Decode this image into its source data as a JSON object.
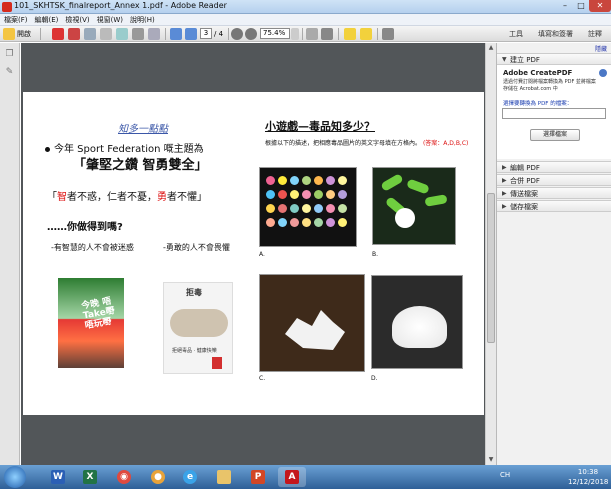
{
  "window": {
    "title": "101_SKHTSK_finalreport_Annex 1.pdf - Adobe Reader",
    "buttons": {
      "minimize": "–",
      "maximize": "□",
      "close": "✕"
    }
  },
  "menubar": {
    "items": [
      "檔案(F)",
      "編輯(E)",
      "檢視(V)",
      "視窗(W)",
      "說明(H)"
    ]
  },
  "toolbar": {
    "open_label": "開啟",
    "page_current": "3",
    "page_total": "/ 4",
    "zoom": "75.4%",
    "tools_label": "工具",
    "sign_label": "填寫和簽署",
    "comment_label": "註釋"
  },
  "document": {
    "left": {
      "heading": "知多一點點",
      "line1": "今年 Sport Federation 嘅主題為",
      "line2": "「肇堅之鑽 智勇雙全」",
      "line3_q1": "「",
      "line3_red1": "智",
      "line3_mid": "者不惑，仁者不憂，",
      "line3_red2": "勇",
      "line3_end": "者不懼」",
      "line4": "……你做得到嗎?",
      "line5": "-有智慧的人不會被迷惑",
      "line6": "-勇敢的人不會畏懼",
      "poster1_text": "今晚 唔Take嘢 唔玩嘢",
      "poster2_top": "拒毒",
      "poster2_text": "拒絕毒品 · 健康快樂"
    },
    "right": {
      "heading": "小遊戲—毒品知多少？",
      "instruction": "根據以下的描述，把相應毒品圖片的英文字母填在方格內。",
      "instruction_red": "(答案：A,D,B,C)",
      "labels": [
        "A.",
        "B.",
        "C.",
        "D."
      ]
    }
  },
  "right_panel": {
    "hide_label": "隱藏",
    "section_create": "建立 PDF",
    "createpdf_title": "Adobe CreatePDF",
    "createpdf_desc": "透過付費訂閱將檔案轉換為 PDF 並將檔案存儲在 Acrobat.com 中",
    "select_link": "選擇要轉換為 PDF 的檔案：",
    "select_button": "選擇檔案",
    "sections": [
      "編輯 PDF",
      "合併 PDF",
      "傳送檔案",
      "儲存檔案"
    ]
  },
  "taskbar": {
    "lang": "CH",
    "time": "10:38",
    "date": "12/12/2018"
  }
}
